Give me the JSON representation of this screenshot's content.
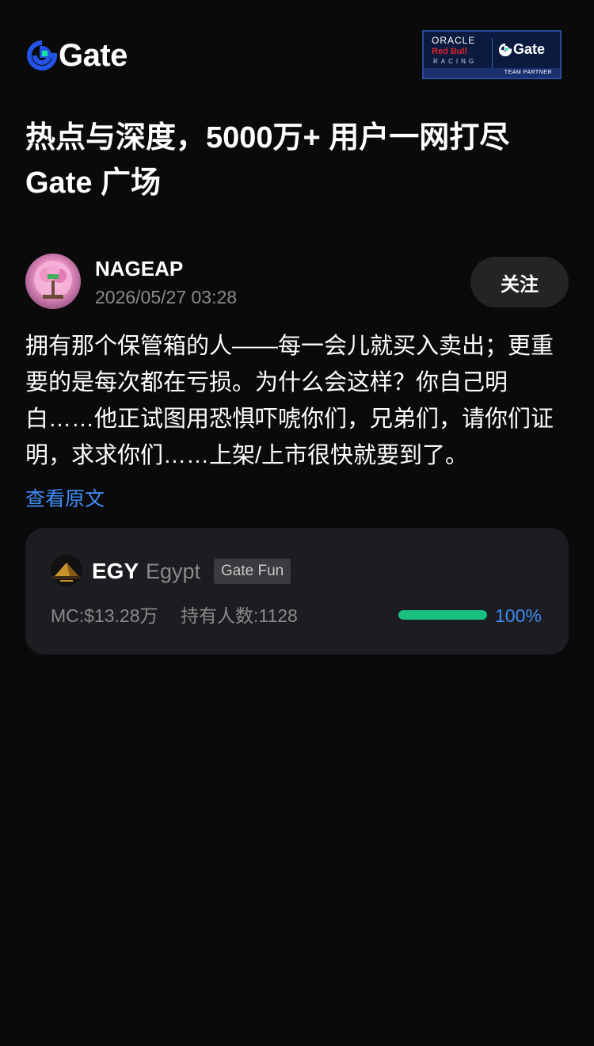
{
  "header": {
    "logo_text": "Gate",
    "partner": {
      "oracle": "ORACLE",
      "redbull": "Red Bull",
      "racing": "RACING",
      "gate": "Gate",
      "team": "TEAM PARTNER"
    }
  },
  "headline": {
    "line1": "热点与深度，5000万+ 用户一网打尽",
    "line2": "Gate 广场"
  },
  "post": {
    "username": "NAGEAP",
    "timestamp": "2026/05/27 03:28",
    "follow_label": "关注",
    "body": "拥有那个保管箱的人——每一会儿就买入卖出；更重要的是每次都在亏损。为什么会这样？你自己明白……他正试图用恐惧吓唬你们，兄弟们，请你们证明，求求你们……上架/上市很快就要到了。",
    "view_original": "查看原文"
  },
  "token": {
    "symbol": "EGY",
    "name": "Egypt",
    "tag": "Gate Fun",
    "market_cap": "MC:$13.28万",
    "holders": "持有人数:1128",
    "progress_percent": 100,
    "progress_text": "100%",
    "progress_color": "#19c082"
  },
  "colors": {
    "background": "#0a0a0a",
    "link": "#3f8bf5",
    "brand_blue": "#2354e6",
    "brand_green": "#17e6a1"
  }
}
